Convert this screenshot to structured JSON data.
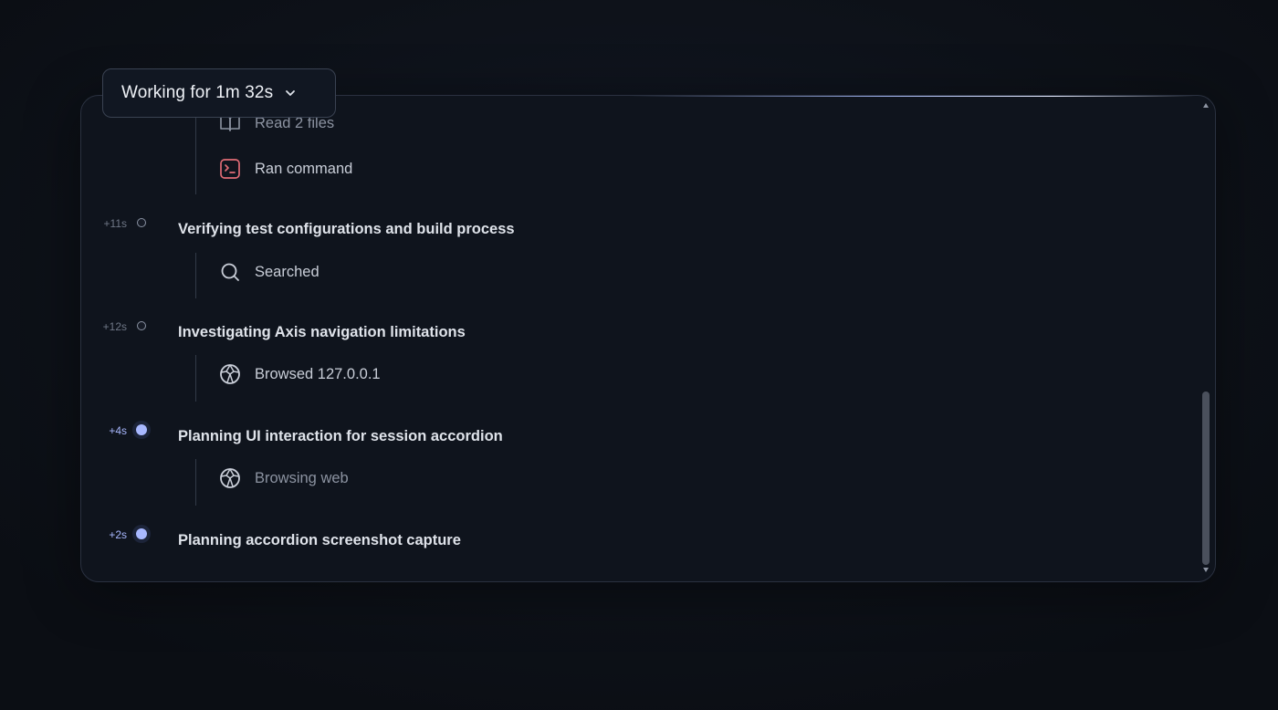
{
  "header": {
    "label": "Working for 1m 32s",
    "chevron_icon": "chevron-down-icon"
  },
  "steps_top": [
    {
      "label": "Read 2 files",
      "icon": "book-icon",
      "dim": true
    },
    {
      "label": "Ran command",
      "icon": "terminal-icon",
      "dim": false
    }
  ],
  "steps": [
    {
      "time": "+11s",
      "title": "Verifying test configurations and build process",
      "active": false,
      "sub": {
        "label": "Searched",
        "icon": "search-icon"
      }
    },
    {
      "time": "+12s",
      "title": "Investigating Axis navigation limitations",
      "active": false,
      "sub": {
        "label": "Browsed 127.0.0.1",
        "icon": "globe-icon"
      }
    },
    {
      "time": "+4s",
      "title": "Planning UI interaction for session accordion",
      "active": true,
      "sub": {
        "label": "Browsing web",
        "icon": "globe-icon"
      }
    },
    {
      "time": "+2s",
      "title": "Planning accordion screenshot capture",
      "active": true
    }
  ],
  "colors": {
    "accent": "#a8b8ff",
    "terminal_icon": "#e06c75",
    "background": "#0d1118"
  }
}
